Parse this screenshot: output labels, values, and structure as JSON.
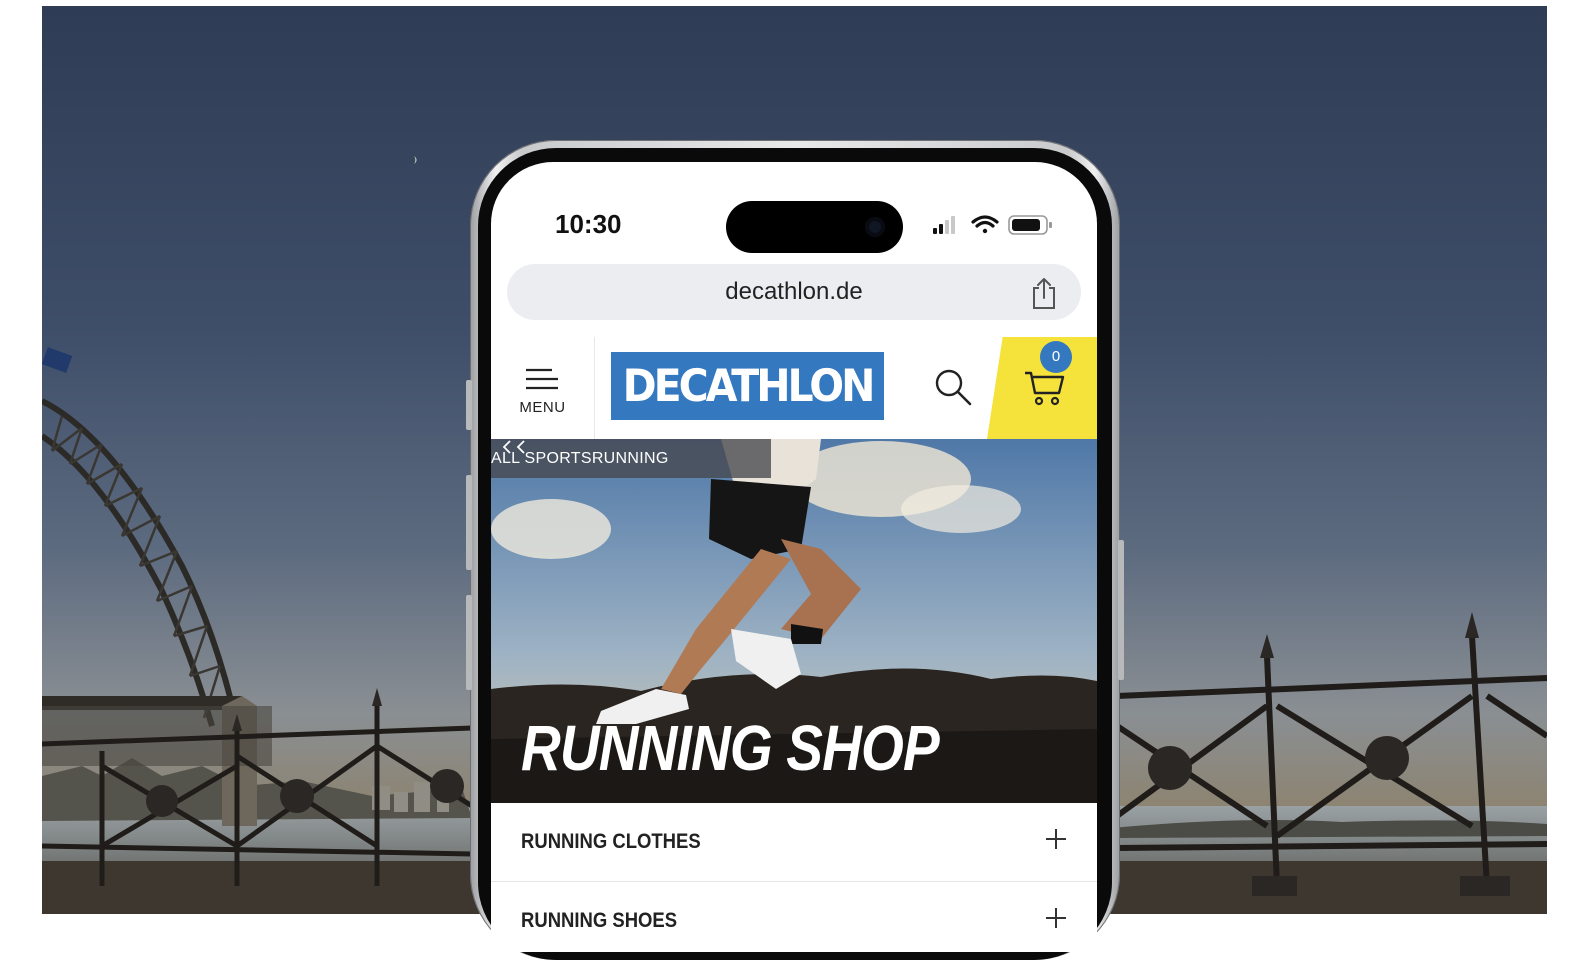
{
  "status_bar": {
    "time": "10:30"
  },
  "browser": {
    "url": "decathlon.de"
  },
  "header": {
    "menu_label": "MENU",
    "logo_text": "DECATHLON",
    "cart_count": "0",
    "brand_blue": "#3479c0",
    "cart_yellow": "#f5e23a"
  },
  "breadcrumb": {
    "items": [
      "ALL SPORTS",
      "RUNNING"
    ]
  },
  "hero": {
    "title": "RUNNING SHOP"
  },
  "categories": [
    {
      "label": "RUNNING CLOTHES"
    },
    {
      "label": "RUNNING SHOES"
    }
  ],
  "icons": [
    "signal-icon",
    "wifi-icon",
    "battery-icon",
    "share-icon",
    "menu-icon",
    "search-icon",
    "cart-icon",
    "chevron-left-icon",
    "plus-icon"
  ]
}
